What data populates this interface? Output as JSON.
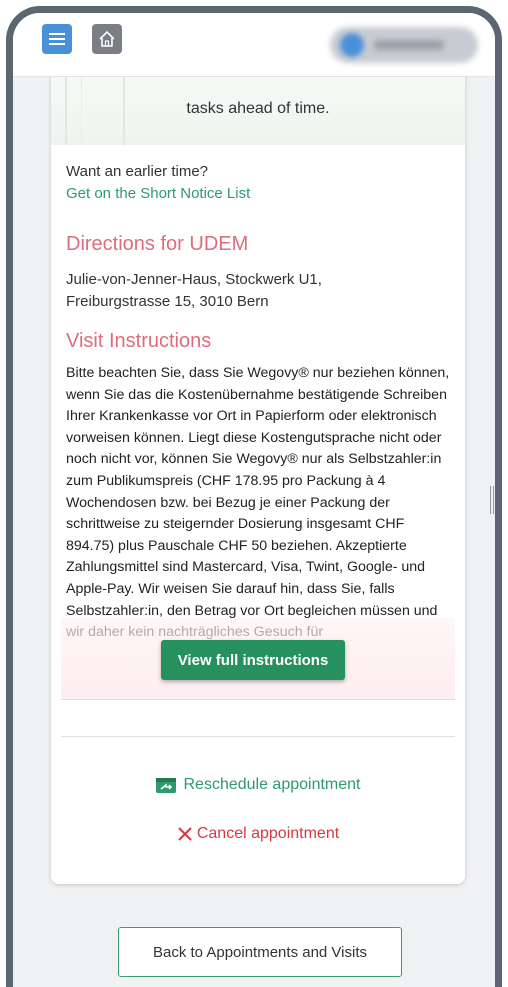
{
  "colors": {
    "accent_green": "#26915e",
    "link_green": "#2f9a6b",
    "heading_pink": "#e06b7c",
    "cancel_red": "#d8383e",
    "menu_blue": "#4a90d9"
  },
  "header": {
    "menu_icon": "hamburger-icon",
    "home_icon": "home-icon"
  },
  "hero": {
    "text": "tasks ahead of time."
  },
  "earlier": {
    "question": "Want an earlier time?",
    "link": "Get on the Short Notice List"
  },
  "directions": {
    "heading": "Directions for UDEM",
    "address_line1": "Julie-von-Jenner-Haus, Stockwerk U1,",
    "address_line2": "Freiburgstrasse 15, 3010 Bern"
  },
  "visit": {
    "heading": "Visit Instructions",
    "text": "Bitte beachten Sie, dass Sie Wegovy® nur beziehen können, wenn Sie das die Kostenübernahme bestätigende Schreiben Ihrer Krankenkasse vor Ort in Papierform oder elektronisch vorweisen können. Liegt diese Kostengutsprache nicht oder noch nicht vor, können Sie Wegovy® nur als Selbstzahler:in zum Publikumspreis (CHF 178.95 pro Packung à 4 Wochendosen bzw. bei Bezug je einer Packung der schrittweise zu steigernder Dosierung insgesamt CHF 894.75) plus Pauschale CHF 50 beziehen. Akzeptierte Zahlungsmittel sind Mastercard, Visa, Twint, Google- und Apple-Pay. Wir weisen Sie darauf hin, dass Sie, falls Selbstzahler:in, den Betrag vor Ort begleichen müssen und wir daher kein nachträgliches Gesuch für",
    "view_full": "View full instructions"
  },
  "actions": {
    "reschedule": "Reschedule appointment",
    "cancel": "Cancel appointment",
    "back": "Back to Appointments and Visits"
  }
}
